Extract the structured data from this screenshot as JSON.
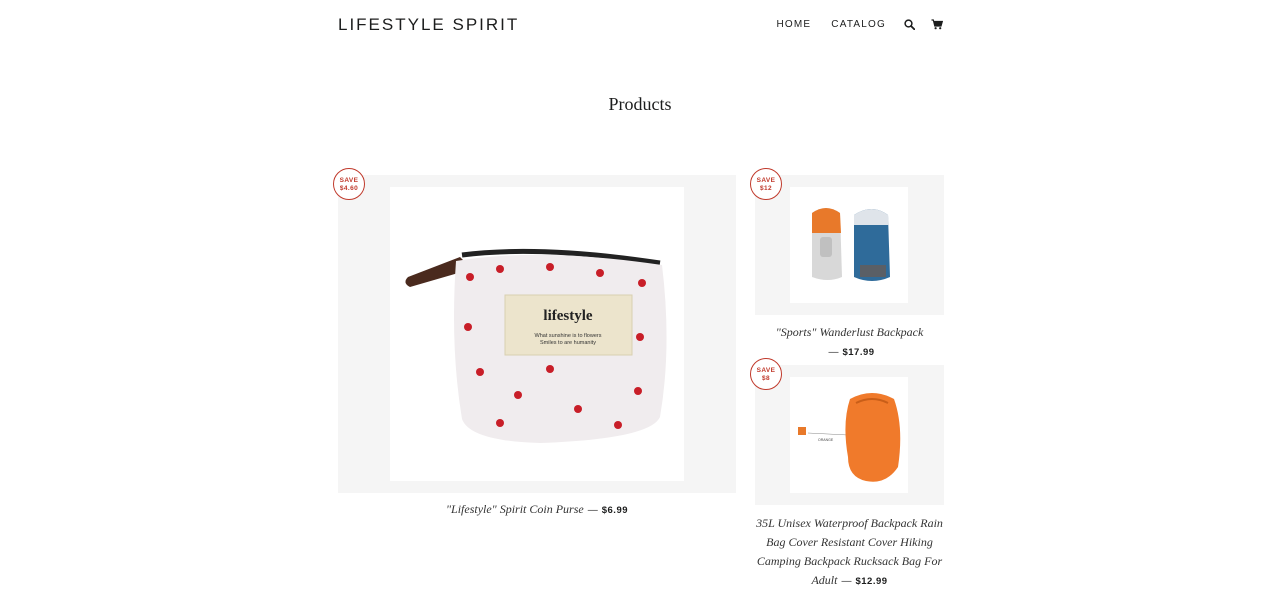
{
  "header": {
    "logo": "LIFESTYLE SPIRIT",
    "nav": {
      "home": "HOME",
      "catalog": "CATALOG"
    },
    "icons": [
      "search-icon",
      "cart-icon"
    ]
  },
  "page": {
    "title": "Products"
  },
  "products": [
    {
      "badge_line1": "SAVE",
      "badge_line2": "$4.60",
      "title": "\"Lifestyle\" Spirit Coin Purse",
      "dash": "—",
      "price": "$6.99",
      "image_text": "lifestyle",
      "image_subtext1": "What sunshine is to flowers",
      "image_subtext2": "Smiles to are humanity"
    },
    {
      "badge_line1": "SAVE",
      "badge_line2": "$12",
      "title": "\"Sports\" Wanderlust Backpack",
      "dash": "—",
      "price": "$17.99"
    },
    {
      "badge_line1": "SAVE",
      "badge_line2": "$8",
      "title": "35L Unisex Waterproof Backpack Rain Bag Cover Resistant Cover Hiking Camping Backpack Rucksack Bag For Adult",
      "dash": "—",
      "price": "$12.99",
      "image_text": "ORANGE"
    }
  ],
  "colors": {
    "badge": "#c0392b",
    "frame": "#f5f5f5",
    "text": "#1c1d1d"
  }
}
